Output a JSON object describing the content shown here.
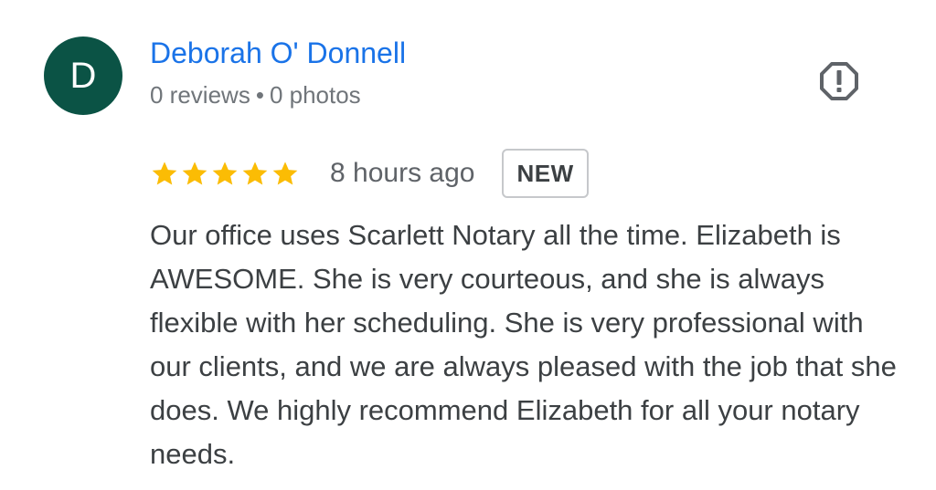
{
  "reviewer": {
    "initial": "D",
    "avatar_color": "#0b5345",
    "name": "Deborah O' Donnell",
    "reviews": "0 reviews",
    "separator": "•",
    "photos": "0 photos"
  },
  "report": {
    "icon": "report-flag-icon"
  },
  "rating": {
    "stars": 5,
    "max_stars": 5,
    "star_color": "#fbbc04",
    "time_ago": "8 hours ago",
    "badge": "NEW"
  },
  "review": {
    "text": "Our office uses Scarlett Notary all the time. Elizabeth is AWESOME. She is very courteous, and she is always flexible with her scheduling. She is very professional with our clients, and we are always pleased with the job that she does. We highly recommend Elizabeth for all your notary needs."
  }
}
